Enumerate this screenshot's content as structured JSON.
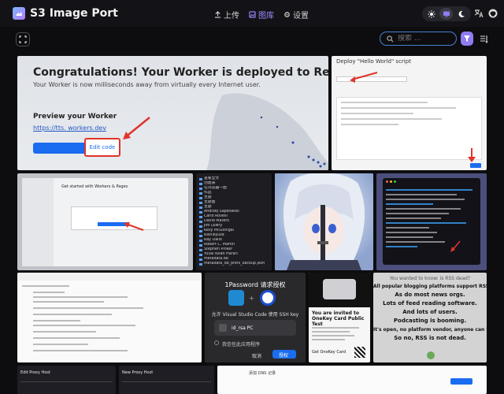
{
  "app": {
    "title": "S3 Image Port"
  },
  "nav": [
    {
      "label": "上传",
      "icon": "upload-icon"
    },
    {
      "label": "图库",
      "icon": "gallery-icon",
      "active": true
    },
    {
      "label": "设置",
      "icon": "gear-icon"
    }
  ],
  "theme": {
    "options": [
      "system",
      "light",
      "dark"
    ],
    "active": "light"
  },
  "search": {
    "placeholder": "搜索 ..."
  },
  "colors": {
    "accent": "#8e7cf0",
    "search_border": "#4a7fd0",
    "background": "#0d0d10"
  },
  "tiles": {
    "t1": {
      "title": "Congratulations! Your Worker is deployed to Region: Earth.",
      "subtitle": "Your Worker is now milliseconds away from virtually every Internet user.",
      "preview_heading": "Preview your Worker",
      "link": "https://tts.         workers.dev",
      "edit_label": "Edit code"
    },
    "t2": {
      "header": "Deploy \"Hello World\" script"
    },
    "t3": {
      "heading": "Get started with Workers & Pages"
    },
    "t4": {
      "items": [
        "查看全文",
        "创建表",
        "在浏览器一图",
        "作品",
        "主题",
        "主题图",
        "主题",
        "Andrzej Sapkowski",
        "Carlo Rovelli",
        "David Matero",
        "Jim Lowry",
        "Kelly McGonigal",
        "Nishikyuza",
        "Ray Dalio",
        "Robert C. Martin",
        "Stephen Pinker",
        "Yuval Noah Harari",
        "metadata.db",
        "metadata_db_prefs_backup.json"
      ]
    },
    "t8": {
      "title": "1Password 请求授权",
      "subtitle": "允许 Visual Studio Code 使用 SSH key",
      "key_name": "id_rsa PC",
      "checkbox": "我信任此应用程序",
      "cancel": "取消",
      "authorize": "授权"
    },
    "t9": {
      "title": "You are invited to OneKey Card Public Test",
      "button": "Get OneKey Card"
    },
    "t10": {
      "lines": [
        "You wanted to know: is RSS dead?",
        "All popular blogging platforms support RSS.",
        "As do most news orgs.",
        "Lots of feed reading software.",
        "And lots of users.",
        "Podcasting is booming.",
        "It's open, no platform vendor, anyone can use it.",
        "So no, RSS is not dead."
      ]
    },
    "t11": {
      "title": "Edit Proxy Host"
    },
    "t12": {
      "title": "New Proxy Host"
    },
    "t13": {
      "title": "添加 DNS 记录"
    }
  }
}
